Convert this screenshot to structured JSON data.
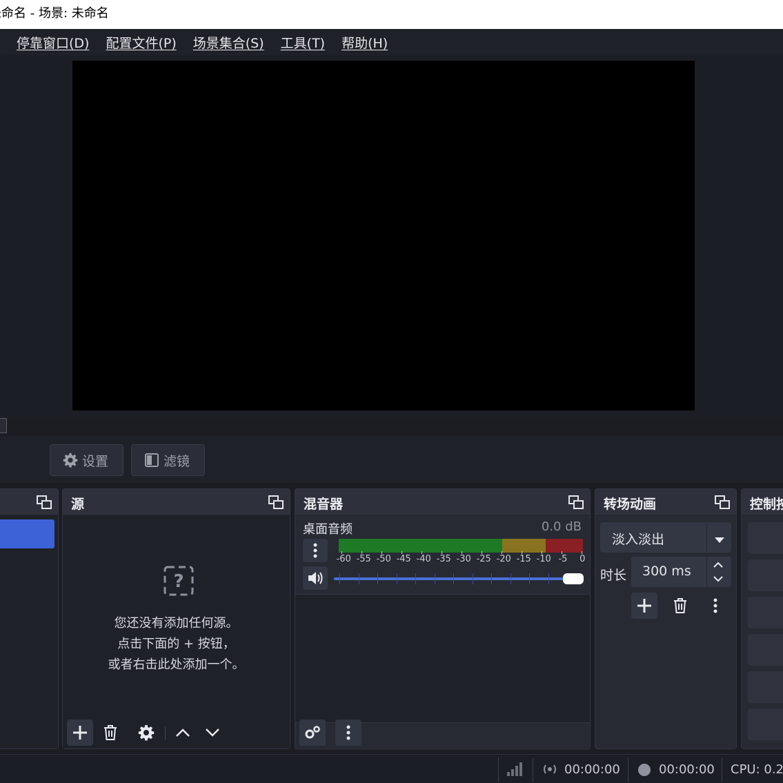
{
  "window": {
    "title": "未命名 - 场景: 未命名"
  },
  "menu": [
    "停靠窗口(D)",
    "配置文件(P)",
    "场景集合(S)",
    "工具(T)",
    "帮助(H)"
  ],
  "toolbar": {
    "settings_label": "设置",
    "filters_label": "滤镜"
  },
  "sources": {
    "title": "源",
    "empty_line1": "您还没有添加任何源。",
    "empty_line2": "点击下面的 + 按钮，",
    "empty_line3": "或者右击此处添加一个。"
  },
  "mixer": {
    "title": "混音器",
    "channel_name": "桌面音频",
    "db_value": "0.0 dB",
    "scale": [
      "-60",
      "-55",
      "-50",
      "-45",
      "-40",
      "-35",
      "-30",
      "-25",
      "-20",
      "-15",
      "-10",
      "-5",
      "0"
    ],
    "volume_fraction": 1.0
  },
  "transitions": {
    "title": "转场动画",
    "selected": "淡入淡出",
    "duration_label": "时长",
    "duration_value": "300 ms"
  },
  "controls": {
    "title": "控制按钮"
  },
  "status": {
    "stream_time": "00:00:00",
    "record_time": "00:00:00",
    "cpu": "CPU: 0.2"
  },
  "colors": {
    "accent": "#3d61d6",
    "meter_green": "#1f7a25",
    "meter_yellow": "#8a7320",
    "meter_red": "#8a1f24",
    "slider": "#4a6fd8"
  }
}
